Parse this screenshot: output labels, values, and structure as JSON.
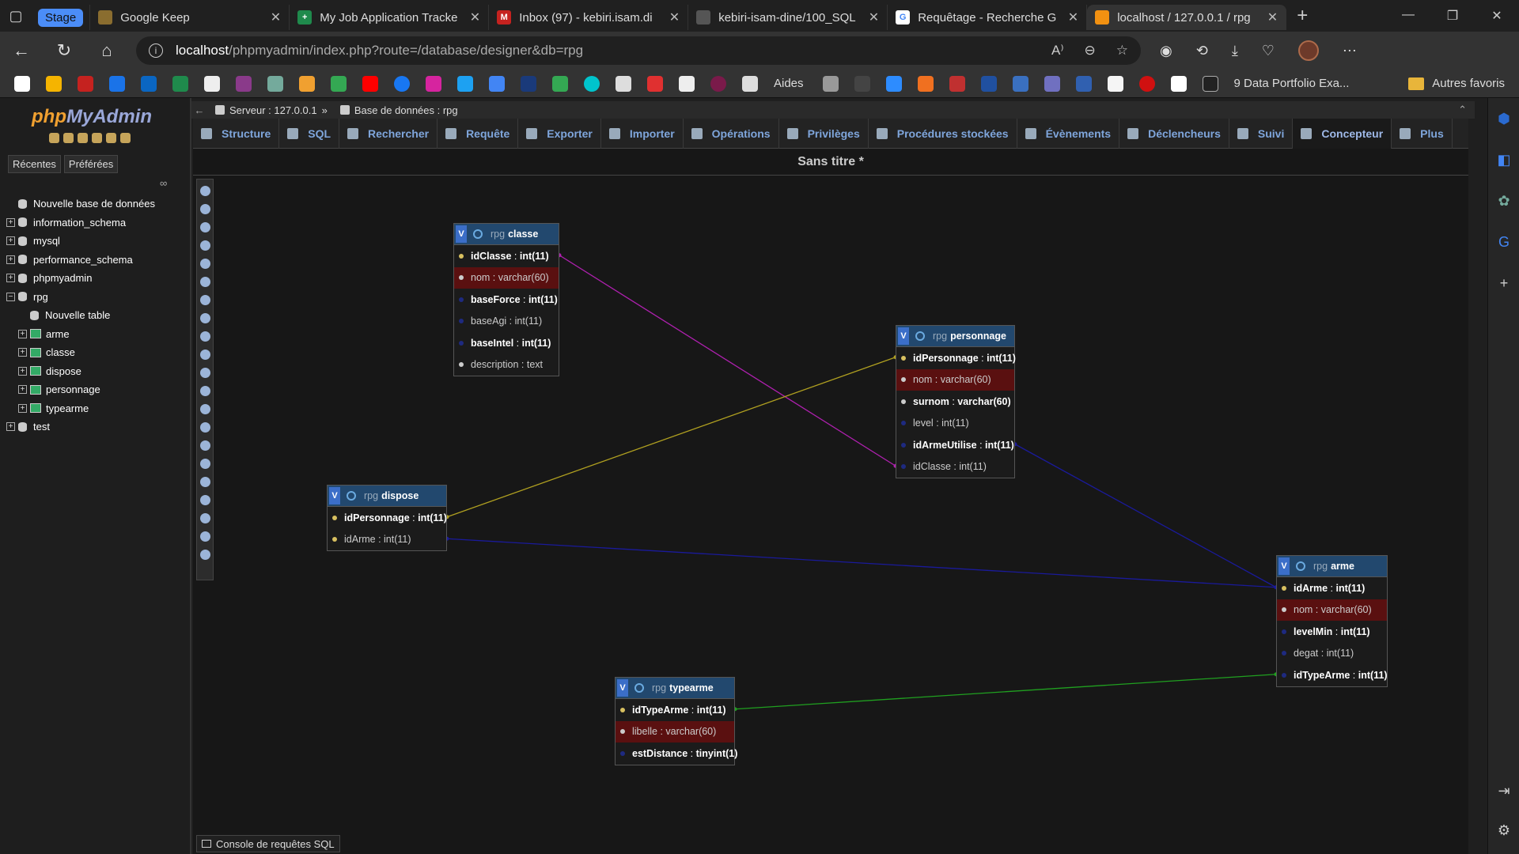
{
  "browser": {
    "tabs": [
      {
        "label": "Stage",
        "group": true
      },
      {
        "label": "Google Keep",
        "icon_color": "#8a6d2f"
      },
      {
        "label": "My Job Application Tracke",
        "icon_color": "#1f8a4c"
      },
      {
        "label": "Inbox (97) - kebiri.isam.di",
        "icon_color": "#c5221f"
      },
      {
        "label": "kebiri-isam-dine/100_SQL",
        "icon_color": "#555555"
      },
      {
        "label": "Requêtage - Recherche G",
        "icon_color": "#4285f4"
      },
      {
        "label": "localhost / 127.0.0.1 / rpg",
        "icon_color": "#f29111",
        "active": true
      }
    ],
    "url": {
      "host": "localhost",
      "path": "/phpmyadmin/index.php?route=/database/designer&db=rpg"
    },
    "bookmarks": [
      "Aides",
      "9 Data Portfolio Exa..."
    ],
    "bookmark_folder": "Autres favoris"
  },
  "pma": {
    "logo_php": "php",
    "logo_myadmin": "MyAdmin",
    "nav_tabs": [
      "Récentes",
      "Préférées"
    ],
    "tree": [
      {
        "label": "Nouvelle base de données",
        "level": 0,
        "toggle": "",
        "kind": "new"
      },
      {
        "label": "information_schema",
        "level": 0,
        "toggle": "+",
        "kind": "db"
      },
      {
        "label": "mysql",
        "level": 0,
        "toggle": "+",
        "kind": "db"
      },
      {
        "label": "performance_schema",
        "level": 0,
        "toggle": "+",
        "kind": "db"
      },
      {
        "label": "phpmyadmin",
        "level": 0,
        "toggle": "+",
        "kind": "db"
      },
      {
        "label": "rpg",
        "level": 0,
        "toggle": "−",
        "kind": "db"
      },
      {
        "label": "Nouvelle table",
        "level": 1,
        "toggle": "",
        "kind": "new"
      },
      {
        "label": "arme",
        "level": 1,
        "toggle": "+",
        "kind": "table"
      },
      {
        "label": "classe",
        "level": 1,
        "toggle": "+",
        "kind": "table"
      },
      {
        "label": "dispose",
        "level": 1,
        "toggle": "+",
        "kind": "table"
      },
      {
        "label": "personnage",
        "level": 1,
        "toggle": "+",
        "kind": "table"
      },
      {
        "label": "typearme",
        "level": 1,
        "toggle": "+",
        "kind": "table"
      },
      {
        "label": "test",
        "level": 0,
        "toggle": "+",
        "kind": "db"
      }
    ],
    "breadcrumb": {
      "server": "Serveur : 127.0.0.1",
      "sep": "»",
      "database": "Base de données : rpg"
    },
    "menu": [
      "Structure",
      "SQL",
      "Rechercher",
      "Requête",
      "Exporter",
      "Importer",
      "Opérations",
      "Privilèges",
      "Procédures stockées",
      "Évènements",
      "Déclencheurs",
      "Suivi",
      "Concepteur",
      "Plus"
    ],
    "active_menu": "Concepteur",
    "designer_title": "Sans titre *",
    "console_label": "Console de requêtes SQL",
    "tables": [
      {
        "id": "classe",
        "schema": "rpg",
        "name": "classe",
        "columns": [
          {
            "name": "idClasse",
            "type": "int(11)",
            "kind": "pk",
            "bold": true
          },
          {
            "name": "nom",
            "type": "varchar(60)",
            "kind": "uq",
            "hl": true
          },
          {
            "name": "baseForce",
            "type": "int(11)",
            "kind": "ni",
            "bold": true
          },
          {
            "name": "baseAgi",
            "type": "int(11)",
            "kind": "ni"
          },
          {
            "name": "baseIntel",
            "type": "int(11)",
            "kind": "ni",
            "bold": true
          },
          {
            "name": "description",
            "type": "text",
            "kind": "uq"
          }
        ]
      },
      {
        "id": "personnage",
        "schema": "rpg",
        "name": "personnage",
        "columns": [
          {
            "name": "idPersonnage",
            "type": "int(11)",
            "kind": "pk",
            "bold": true
          },
          {
            "name": "nom",
            "type": "varchar(60)",
            "kind": "uq",
            "hl": true
          },
          {
            "name": "surnom",
            "type": "varchar(60)",
            "kind": "uq",
            "bold": true
          },
          {
            "name": "level",
            "type": "int(11)",
            "kind": "ni"
          },
          {
            "name": "idArmeUtilise",
            "type": "int(11)",
            "kind": "ni",
            "bold": true
          },
          {
            "name": "idClasse",
            "type": "int(11)",
            "kind": "ni"
          }
        ]
      },
      {
        "id": "dispose",
        "schema": "rpg",
        "name": "dispose",
        "columns": [
          {
            "name": "idPersonnage",
            "type": "int(11)",
            "kind": "pk",
            "bold": true
          },
          {
            "name": "idArme",
            "type": "int(11)",
            "kind": "pk"
          }
        ]
      },
      {
        "id": "arme",
        "schema": "rpg",
        "name": "arme",
        "columns": [
          {
            "name": "idArme",
            "type": "int(11)",
            "kind": "pk",
            "bold": true
          },
          {
            "name": "nom",
            "type": "varchar(60)",
            "kind": "uq",
            "hl": true
          },
          {
            "name": "levelMin",
            "type": "int(11)",
            "kind": "ni",
            "bold": true
          },
          {
            "name": "degat",
            "type": "int(11)",
            "kind": "ni"
          },
          {
            "name": "idTypeArme",
            "type": "int(11)",
            "kind": "ni",
            "bold": true
          }
        ]
      },
      {
        "id": "typearme",
        "schema": "rpg",
        "name": "typearme",
        "columns": [
          {
            "name": "idTypeArme",
            "type": "int(11)",
            "kind": "pk",
            "bold": true
          },
          {
            "name": "libelle",
            "type": "varchar(60)",
            "kind": "uq",
            "hl": true
          },
          {
            "name": "estDistance",
            "type": "tinyint(1)",
            "kind": "ni",
            "bold": true
          }
        ]
      }
    ],
    "relations": [
      {
        "from": "classe.idClasse",
        "to": "personnage.idClasse",
        "color": "#b020b0"
      },
      {
        "from": "dispose.idPersonnage",
        "to": "personnage.idPersonnage",
        "color": "#b0a020"
      },
      {
        "from": "dispose.idArme",
        "to": "arme.idArme",
        "color": "#1a1a9a"
      },
      {
        "from": "personnage.idArmeUtilise",
        "to": "arme.idArme",
        "color": "#1a1a9a"
      },
      {
        "from": "typearme.idTypeArme",
        "to": "arme.idTypeArme",
        "color": "#20a020"
      }
    ]
  }
}
